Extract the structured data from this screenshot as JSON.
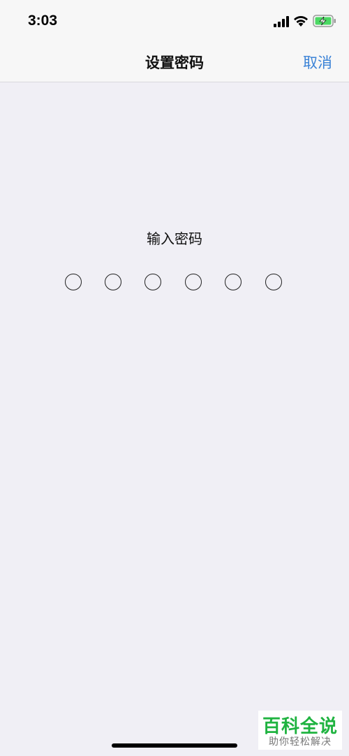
{
  "status_bar": {
    "time": "3:03",
    "icons": [
      "cellular-signal-icon",
      "wifi-icon",
      "battery-charging-icon"
    ],
    "battery_color": "#4cd964"
  },
  "nav": {
    "title": "设置密码",
    "cancel_label": "取消",
    "accent_color": "#3a82d6"
  },
  "passcode": {
    "prompt": "输入密码",
    "digits_total": 6,
    "digits_entered": 0
  },
  "watermark": {
    "title": "百科全说",
    "subtitle": "助你轻松解决",
    "color": "#1fb340"
  }
}
